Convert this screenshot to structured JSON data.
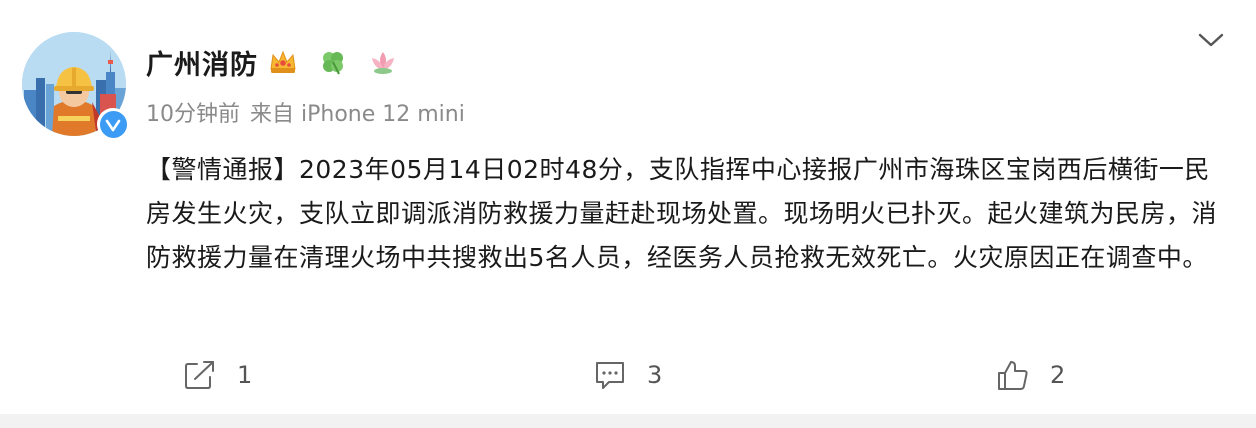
{
  "post": {
    "author": {
      "name": "广州消防",
      "badges": [
        "crown-badge-icon",
        "clover-badge-icon",
        "lotus-badge-icon"
      ],
      "verified": true,
      "verified_color": "#3b9bf5"
    },
    "meta": {
      "time": "10分钟前",
      "source": "来自 iPhone 12 mini"
    },
    "text": "【警情通报】2023年05月14日02时48分，支队指挥中心接报广州市海珠区宝岗西后横街一民房发生火灾，支队立即调派消防救援力量赶赴现场处置。现场明火已扑灭。起火建筑为民房，消防救援力量在清理火场中共搜救出5名人员，经医务人员抢救无效死亡。火灾原因正在调查中。",
    "actions": {
      "repost_count": "1",
      "comment_count": "3",
      "like_count": "2"
    }
  },
  "colors": {
    "text_primary": "#1a1a1a",
    "text_secondary": "#8a8a8a",
    "icon_gray": "#666666",
    "background": "#ffffff",
    "divider": "#f2f2f2"
  }
}
